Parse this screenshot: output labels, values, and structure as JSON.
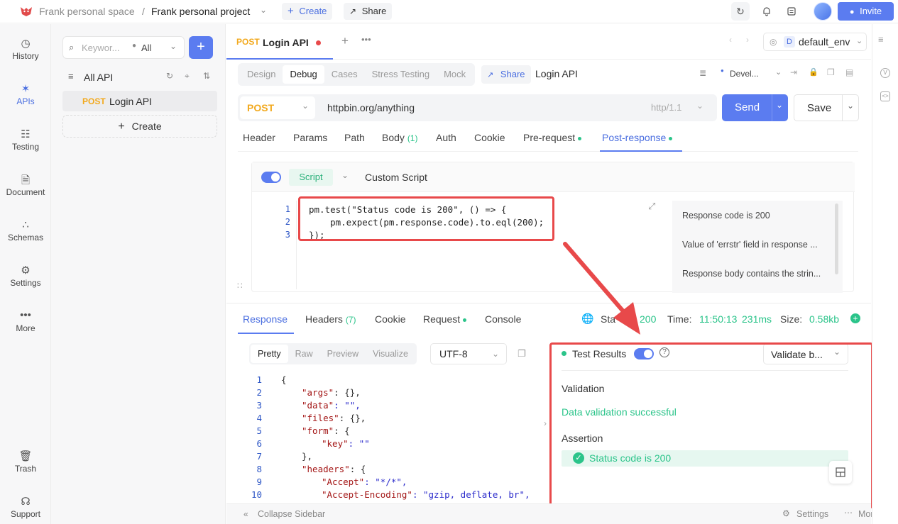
{
  "topbar": {
    "space": "Frank personal space",
    "separator": "/",
    "project": "Frank personal project",
    "create_label": "Create",
    "share_label": "Share",
    "invite_label": "Invite"
  },
  "rail": {
    "items": [
      {
        "label": "History",
        "icon": "history-icon"
      },
      {
        "label": "APIs",
        "icon": "apis-icon"
      },
      {
        "label": "Testing",
        "icon": "testing-icon"
      },
      {
        "label": "Document",
        "icon": "document-icon"
      },
      {
        "label": "Schemas",
        "icon": "schemas-icon"
      },
      {
        "label": "Settings",
        "icon": "settings-icon"
      },
      {
        "label": "More",
        "icon": "more-icon"
      },
      {
        "label": "Trash",
        "icon": "trash-icon"
      },
      {
        "label": "Support",
        "icon": "support-icon"
      }
    ]
  },
  "apilist": {
    "search_placeholder": "Keywor...",
    "filter": "All",
    "root_label": "All API",
    "item_method": "POST",
    "item_name": "Login API",
    "create_label": "Create"
  },
  "main": {
    "tab_method": "POST",
    "tab_name": "Login API",
    "env_letter": "D",
    "env_name": "default_env",
    "mode_tabs": [
      "Design",
      "Debug",
      "Cases",
      "Stress Testing",
      "Mock"
    ],
    "share_label": "Share",
    "api_name": "Login API",
    "env_status": "Devel...",
    "method": "POST",
    "url": "httpbin.org/anything",
    "protocol": "http/1.1",
    "send_label": "Send",
    "save_label": "Save",
    "req_tabs": {
      "header": "Header",
      "params": "Params",
      "path": "Path",
      "body": "Body",
      "body_count": "(1)",
      "auth": "Auth",
      "cookie": "Cookie",
      "pre": "Pre-request",
      "post": "Post-response"
    },
    "script_tag": "Script",
    "script_title": "Custom Script",
    "code_lines": [
      {
        "n": "1",
        "text": "pm.test(\"Status code is 200\", () => {"
      },
      {
        "n": "2",
        "text": "    pm.expect(pm.response.code).to.eql(200);"
      },
      {
        "n": "3",
        "text": "});"
      }
    ],
    "snippets": [
      "Response code is 200",
      "Value of 'errstr' field in response ...",
      "Response body contains the strin..."
    ]
  },
  "response": {
    "tabs": {
      "response": "Response",
      "headers": "Headers",
      "headers_count": "(7)",
      "cookie": "Cookie",
      "request": "Request",
      "console": "Console"
    },
    "status_label": "Sta",
    "status_code": "200",
    "time_label": "Time:",
    "time_value": "11:50:13",
    "duration": "231ms",
    "size_label": "Size:",
    "size_value": "0.58kb",
    "format_tabs": [
      "Pretty",
      "Raw",
      "Preview",
      "Visualize"
    ],
    "encoding": "UTF-8",
    "json_lines": [
      {
        "n": "1",
        "text": "{"
      },
      {
        "n": "2",
        "key": "\"args\"",
        "rest": ": {},"
      },
      {
        "n": "3",
        "key": "\"data\"",
        "rest": ": \"\","
      },
      {
        "n": "4",
        "key": "\"files\"",
        "rest": ": {},"
      },
      {
        "n": "5",
        "key": "\"form\"",
        "rest": ": {"
      },
      {
        "n": "6",
        "key": "\"key\"",
        "rest": ": \"\""
      },
      {
        "n": "7",
        "text": "},"
      },
      {
        "n": "8",
        "key": "\"headers\"",
        "rest": ": {"
      },
      {
        "n": "9",
        "key": "\"Accept\"",
        "rest": ": \"*/*\","
      },
      {
        "n": "10",
        "key": "\"Accept-Encoding\"",
        "rest": ": \"gzip, deflate, br\","
      }
    ],
    "test_results_label": "Test Results",
    "validate_label": "Validate b...",
    "validation_title": "Validation",
    "validation_result": "Data validation successful",
    "assertion_title": "Assertion",
    "assertion_result": "Status code is 200"
  },
  "footer": {
    "collapse_label": "Collapse Sidebar",
    "settings_label": "Settings",
    "more_label": "More"
  },
  "colors": {
    "accent": "#5b7cf0",
    "success": "#2bc48a",
    "post_method": "#f2a91e",
    "highlight_box": "#e8494a"
  }
}
